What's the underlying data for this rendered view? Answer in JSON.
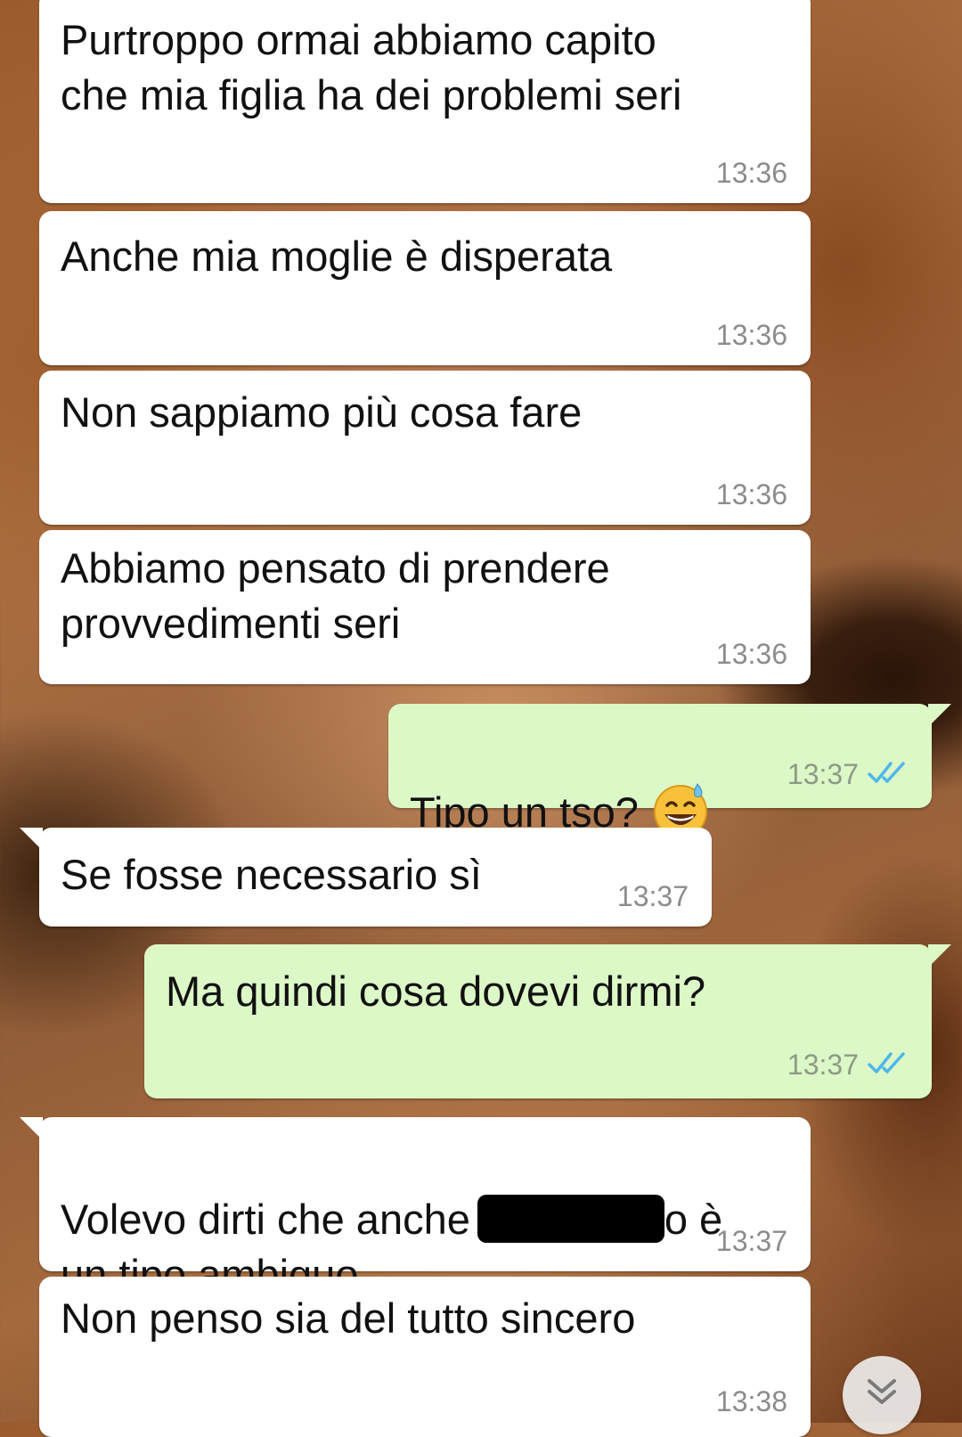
{
  "messages": [
    {
      "direction": "incoming",
      "text": "Purtroppo ormai abbiamo capito\nche mia figlia ha dei problemi seri",
      "time": "13:36"
    },
    {
      "direction": "incoming",
      "text": "Anche mia moglie è disperata",
      "time": "13:36"
    },
    {
      "direction": "incoming",
      "text": "Non sappiamo più cosa fare",
      "time": "13:36"
    },
    {
      "direction": "incoming",
      "text": "Abbiamo pensato di prendere\nprovvedimenti seri",
      "time": "13:36"
    },
    {
      "direction": "outgoing",
      "text": "Tipo un tso?",
      "emoji": "grinning-face-with-sweat-emoji",
      "time": "13:37",
      "status": "read"
    },
    {
      "direction": "incoming",
      "text": "Se fosse necessario sì",
      "time": "13:37"
    },
    {
      "direction": "outgoing",
      "text": "Ma quindi cosa dovevi dirmi?",
      "time": "13:37",
      "status": "read"
    },
    {
      "direction": "incoming",
      "text_before": "Volevo dirti che anche",
      "text_after": "o è",
      "text_line2": "un tipo ambiguo",
      "redacted": true,
      "time": "13:37"
    },
    {
      "direction": "incoming",
      "text": "Non penso sia del tutto sincero",
      "time": "13:38"
    }
  ],
  "scroll_button": {
    "icon": "double-chevron-down-icon"
  },
  "colors": {
    "incoming_bubble": "#ffffff",
    "outgoing_bubble": "#dcf8c6",
    "read_ticks": "#4fb6ec",
    "timestamp": "#8c8c8c"
  }
}
